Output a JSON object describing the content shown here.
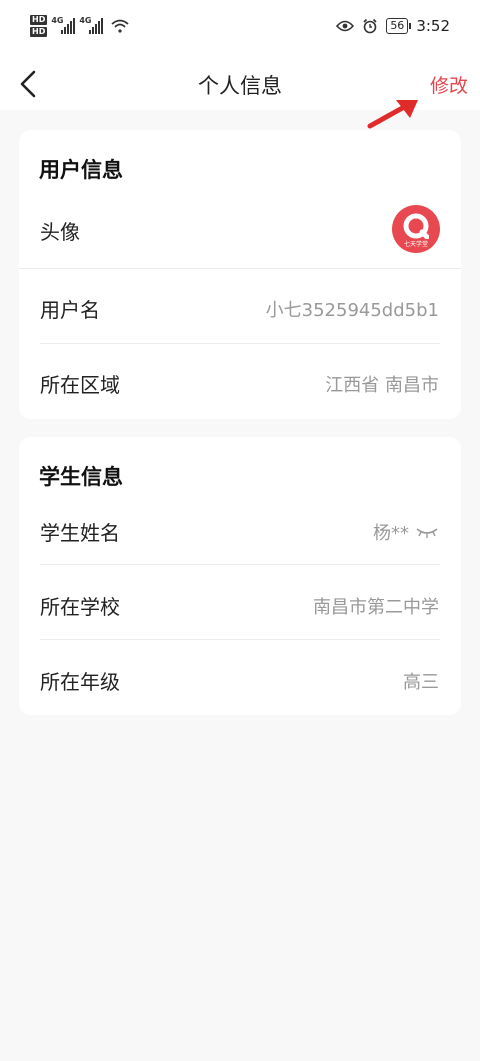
{
  "status_bar": {
    "hd_top": "HD",
    "hd_bottom": "HD",
    "net1": "4G",
    "net2": "4G",
    "battery": "56",
    "time": "3:52"
  },
  "nav": {
    "title": "个人信息",
    "edit_label": "修改"
  },
  "user_card": {
    "title": "用户信息",
    "avatar_label": "头像",
    "avatar_brand": "七天学堂",
    "rows": [
      {
        "label": "用户名",
        "value": "小七3525945dd5b1"
      },
      {
        "label": "所在区域",
        "value": "江西省 南昌市"
      }
    ]
  },
  "student_card": {
    "title": "学生信息",
    "rows": [
      {
        "label": "学生姓名",
        "value": "杨**"
      },
      {
        "label": "所在学校",
        "value": "南昌市第二中学"
      },
      {
        "label": "所在年级",
        "value": "高三"
      }
    ]
  },
  "colors": {
    "accent": "#e2474e",
    "background": "#f8f8f8",
    "card": "#ffffff"
  }
}
